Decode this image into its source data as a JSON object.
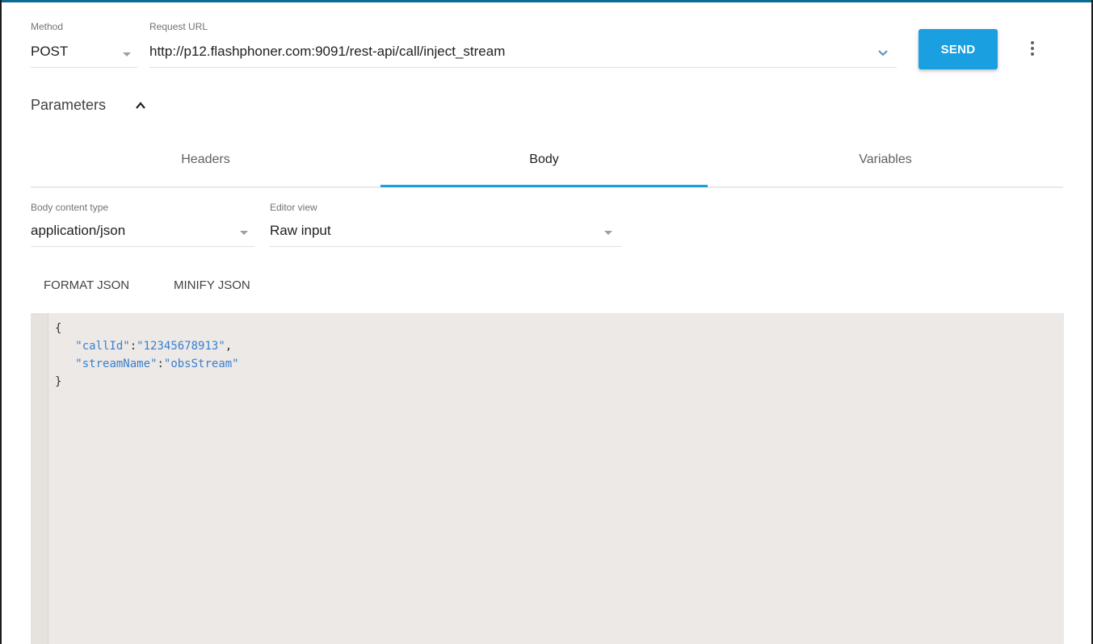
{
  "request": {
    "method_label": "Method",
    "method_value": "POST",
    "url_label": "Request URL",
    "url_value": "http://p12.flashphoner.com:9091/rest-api/call/inject_stream",
    "send_label": "SEND"
  },
  "parameters": {
    "title": "Parameters",
    "tabs": [
      {
        "label": "Headers"
      },
      {
        "label": "Body"
      },
      {
        "label": "Variables"
      }
    ],
    "active_tab": "Body"
  },
  "body_settings": {
    "content_type_label": "Body content type",
    "content_type_value": "application/json",
    "editor_view_label": "Editor view",
    "editor_view_value": "Raw input",
    "format_label": "FORMAT JSON",
    "minify_label": "MINIFY JSON"
  },
  "editor": {
    "open_brace": "{",
    "close_brace": "}",
    "entries": [
      {
        "key": "\"callId\"",
        "value": "\"12345678913\"",
        "sep": ":",
        "trail": ","
      },
      {
        "key": "\"streamName\"",
        "value": "\"obsStream\"",
        "sep": ":",
        "trail": ""
      }
    ]
  },
  "colors": {
    "accent": "#1a9fe0",
    "editor_bg": "#ece9e6",
    "json_token": "#3a7fd0"
  },
  "icons": {
    "url_dropdown": "chevron-down-icon",
    "more": "more-vertical-icon",
    "params_toggle": "chevron-up-icon"
  }
}
